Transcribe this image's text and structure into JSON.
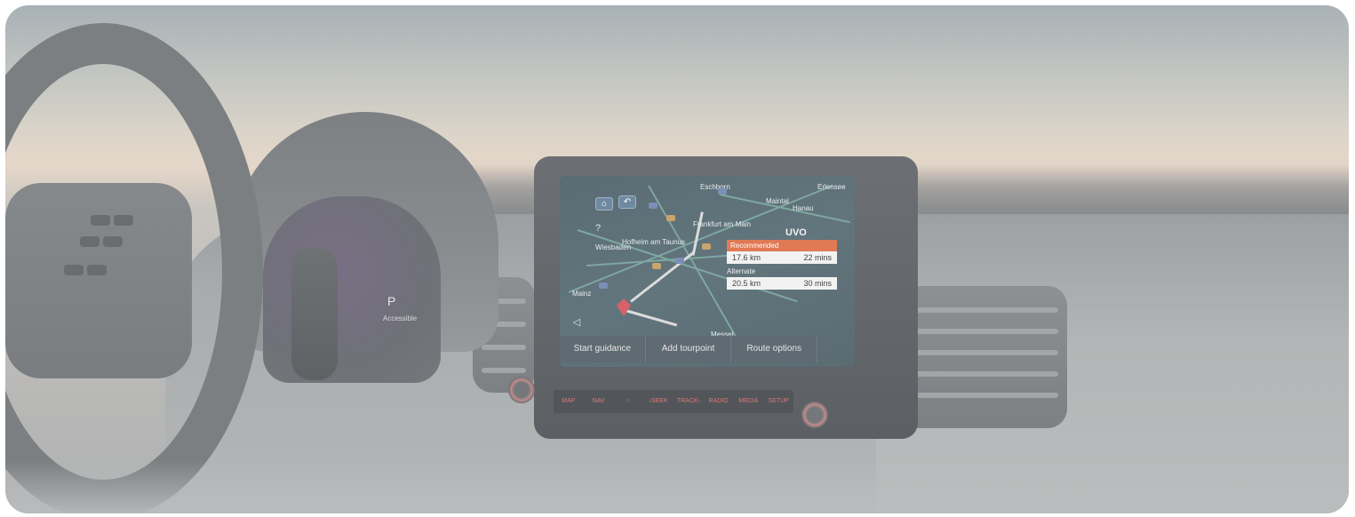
{
  "screen": {
    "back_icon": "return-icon",
    "home_icon": "home-icon",
    "map_labels": [
      "Eschborn",
      "Frankfurt am Main",
      "Maintal",
      "Erlensee",
      "Hanau",
      "Hofheim am Taunus",
      "Wiesbaden",
      "Mainz",
      "Messel"
    ],
    "brand": "UVO",
    "route_panel": {
      "recommended_label": "Recommended",
      "recommended_distance": "17.6 km",
      "recommended_time": "22 mins",
      "alternate_label": "Alternate",
      "alternate_distance": "20.5 km",
      "alternate_time": "30 mins"
    },
    "buttons": [
      "Start guidance",
      "Add tourpoint",
      "Route options"
    ]
  },
  "hardware_buttons": [
    "MAP",
    "NAV",
    "☆",
    "‹SEEK",
    "TRACK›",
    "RADIO",
    "MEDIA",
    "SETUP"
  ],
  "cluster": {
    "gear": "P",
    "subtext": "Accessible"
  },
  "colors": {
    "recommended": "#e07a55",
    "hardware_text": "#d97a7a"
  }
}
